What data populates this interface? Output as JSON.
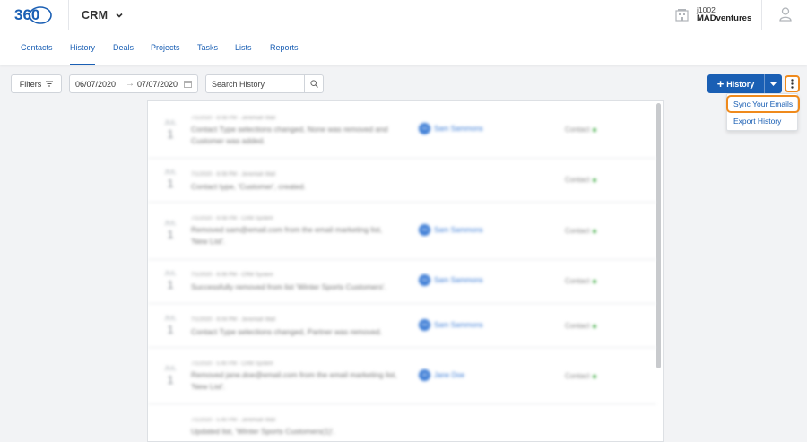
{
  "header": {
    "logo_alt": "360",
    "app_name": "CRM",
    "account_id": "j1002",
    "account_name": "MADventures"
  },
  "nav": {
    "tabs": [
      {
        "label": "Contacts"
      },
      {
        "label": "History",
        "active": true
      },
      {
        "label": "Deals"
      },
      {
        "label": "Projects"
      },
      {
        "label": "Tasks"
      },
      {
        "label": "Lists"
      },
      {
        "label": "Reports"
      }
    ]
  },
  "toolbar": {
    "filters_label": "Filters",
    "date_from": "06/07/2020",
    "date_to": "07/07/2020",
    "date_separator": "→",
    "search_placeholder": "Search History",
    "add_label": "History",
    "add_plus": "+"
  },
  "menu": {
    "sync_label": "Sync Your Emails",
    "export_label": "Export History"
  },
  "history": {
    "rows": [
      {
        "month": "JUL",
        "day": "1",
        "meta": "7/1/2020 - 8:08 PM - Jeremiah Wall",
        "desc": "Contact Type selections changed, None was removed and Customer was added.",
        "contact": "Sam Sammons",
        "initials": "SS",
        "type": "Contact"
      },
      {
        "month": "JUL",
        "day": "1",
        "meta": "7/1/2020 - 8:08 PM - Jeremiah Wall",
        "desc": "Contact type, 'Customer', created.",
        "contact": "",
        "initials": "",
        "type": "Contact"
      },
      {
        "month": "JUL",
        "day": "1",
        "meta": "7/1/2020 - 6:08 PM - CRM System",
        "desc": "Removed sam@email.com from the email marketing list, 'New List'.",
        "contact": "Sam Sammons",
        "initials": "SS",
        "type": "Contact"
      },
      {
        "month": "JUL",
        "day": "1",
        "meta": "7/1/2020 - 6:06 PM - CRM System",
        "desc": "Successfully removed from list 'Winter Sports Customers'.",
        "contact": "Sam Sammons",
        "initials": "SS",
        "type": "Contact"
      },
      {
        "month": "JUL",
        "day": "1",
        "meta": "7/1/2020 - 6:04 PM - Jeremiah Wall",
        "desc": "Contact Type selections changed, Partner was removed.",
        "contact": "Sam Sammons",
        "initials": "SS",
        "type": "Contact"
      },
      {
        "month": "JUL",
        "day": "1",
        "meta": "7/1/2020 - 5:40 PM - CRM System",
        "desc": "Removed jane.doe@email.com from the email marketing list, 'New List'.",
        "contact": "Jane Doe",
        "initials": "JD",
        "type": "Contact"
      },
      {
        "month": "",
        "day": "",
        "meta": "7/1/2020 - 5:40 PM - Jeremiah Wall",
        "desc": "Updated list, 'Winter Sports Customers(1)'.",
        "contact": "",
        "initials": "",
        "type": ""
      }
    ]
  },
  "colors": {
    "brand_blue": "#1a5fb4",
    "highlight_orange": "#ef8a1c",
    "status_green": "#4caf50"
  }
}
